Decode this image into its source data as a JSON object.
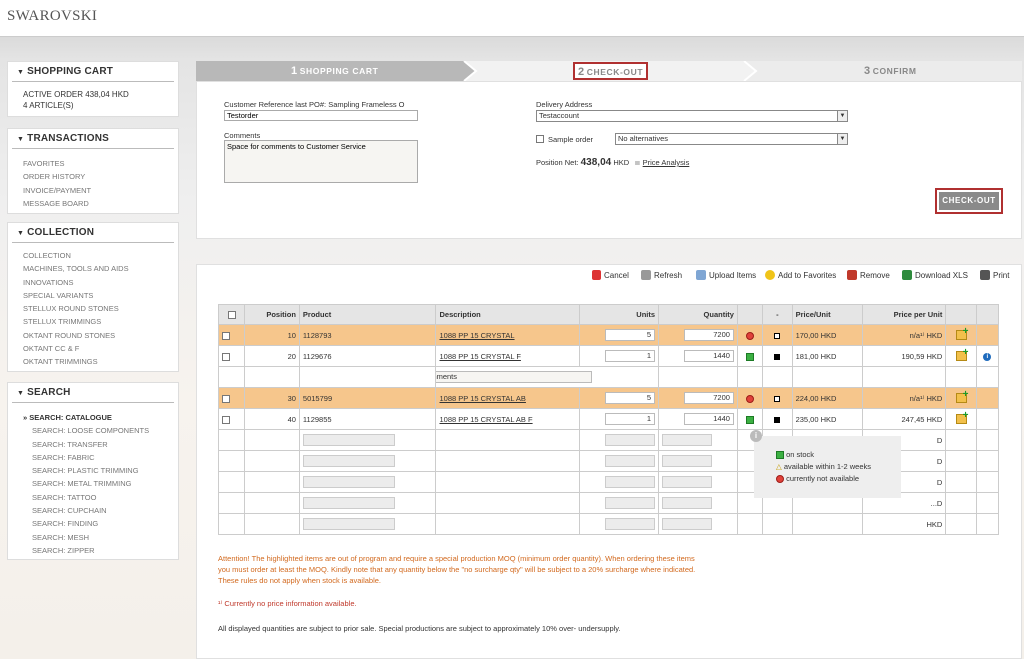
{
  "logo": "SWAROVSKI",
  "sidebar": {
    "cart": {
      "title": "SHOPPING CART",
      "active_order": "ACTIVE ORDER 438,04 HKD",
      "articles": "4 ARTICLE(S)"
    },
    "transactions": {
      "title": "TRANSACTIONS",
      "items": [
        "FAVORITES",
        "ORDER HISTORY",
        "INVOICE/PAYMENT",
        "MESSAGE BOARD"
      ]
    },
    "collection": {
      "title": "COLLECTION",
      "items": [
        "COLLECTION",
        "MACHINES, TOOLS AND AIDS",
        "INNOVATIONS",
        "SPECIAL VARIANTS",
        "STELLUX ROUND STONES",
        "STELLUX TRIMMINGS",
        "OKTANT ROUND STONES",
        "OKTANT CC & F",
        "OKTANT TRIMMINGS"
      ]
    },
    "search": {
      "title": "SEARCH",
      "catalogue": "SEARCH: CATALOGUE",
      "items": [
        "SEARCH: LOOSE COMPONENTS",
        "SEARCH: TRANSFER",
        "SEARCH: FABRIC",
        "SEARCH: PLASTIC TRIMMING",
        "SEARCH: METAL TRIMMING",
        "SEARCH: TATTOO",
        "SEARCH: CUPCHAIN",
        "SEARCH: FINDING",
        "SEARCH: MESH",
        "SEARCH: ZIPPER"
      ]
    }
  },
  "steps": [
    {
      "num": "1",
      "label": "SHOPPING CART"
    },
    {
      "num": "2",
      "label": "CHECK-OUT"
    },
    {
      "num": "3",
      "label": "CONFIRM"
    }
  ],
  "checkout": {
    "customer_ref_label": "Customer Reference last PO#: Sampling Frameless O",
    "customer_ref_value": "Testorder",
    "comments_label": "Comments",
    "comments_value": "Space for comments to Customer Service",
    "delivery_label": "Delivery Address",
    "delivery_value": "Testaccount",
    "sample_label": "Sample order",
    "alternatives_value": "No alternatives",
    "position_net_label": "Position Net:",
    "position_net_value": "438,04",
    "position_net_currency": "HKD",
    "price_analysis": "Price Analysis",
    "button": "CHECK-OUT"
  },
  "toolbar": [
    "Cancel",
    "Refresh",
    "Upload Items",
    "Add to Favorites",
    "Remove",
    "Download XLS",
    "Print"
  ],
  "colors": {
    "accent_red": "#b03030",
    "highlight_row": "#f6c68c",
    "on_stock": "#3cb043",
    "not_available": "#e0413a"
  },
  "table": {
    "headers": [
      "Position",
      "Product",
      "Description",
      "Units",
      "Quantity",
      "-",
      "Price/Unit",
      "Price per Unit"
    ],
    "rows": [
      {
        "position": "10",
        "product": "1128793",
        "description": "1088 PP 15 CRYSTAL",
        "units": "5",
        "quantity": "7200",
        "price_unit": "170,00 HKD",
        "price_per_unit": "n/a¹⁾ HKD",
        "highlight": true,
        "status": "not_available"
      },
      {
        "position": "20",
        "product": "1129676",
        "description": "1088 PP 15 CRYSTAL F",
        "units": "1",
        "quantity": "1440",
        "price_unit": "181,00 HKD",
        "price_per_unit": "190,59 HKD",
        "highlight": false,
        "status": "on_stock"
      },
      {
        "position": "30",
        "product": "5015799",
        "description": "1088 PP 15 CRYSTAL AB",
        "units": "5",
        "quantity": "7200",
        "price_unit": "224,00 HKD",
        "price_per_unit": "n/a¹⁾ HKD",
        "highlight": true,
        "status": "not_available"
      },
      {
        "position": "40",
        "product": "1129855",
        "description": "1088 PP 15 CRYSTAL AB F",
        "units": "1",
        "quantity": "1440",
        "price_unit": "235,00 HKD",
        "price_per_unit": "247,45 HKD",
        "highlight": false,
        "status": "on_stock"
      }
    ],
    "line_comment": "Space for line comments",
    "empty_row_tails": [
      "D",
      "D",
      "D",
      "...D",
      "HKD"
    ]
  },
  "legend": {
    "on_stock": "on stock",
    "within": "available within 1-2 weeks",
    "not_available": "currently not available"
  },
  "notes": {
    "attention": "Attention! The highlighted items are out of program and require a special production MOQ (minimum order quantity). When ordering these items",
    "attention2": "you must order at least the MOQ. Kindly note that any quantity below the \"no surcharge qty\" will be subject to a 20% surcharge where indicated.",
    "attention3": "These rules do not apply when stock is available.",
    "footnote": "¹⁾ Currently no price information available.",
    "disclaimer": "All displayed quantities are subject to prior sale.  Special productions are subject to approximately 10% over- undersupply."
  }
}
